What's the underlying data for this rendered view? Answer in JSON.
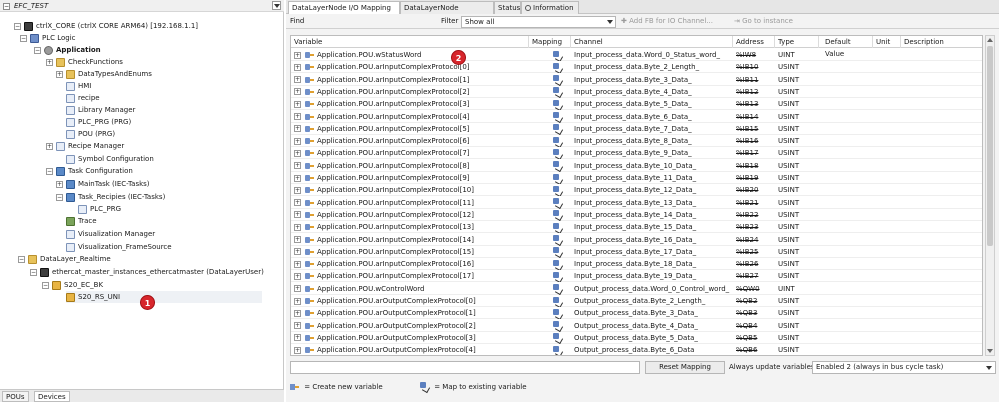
{
  "left": {
    "header_title": "EFC_TEST",
    "tree": [
      {
        "label": "ctrlX_CORE (ctrlX CORE ARM64) [192.168.1.1]",
        "icon": "device-icon"
      },
      {
        "label": "PLC Logic",
        "icon": "plc-icon"
      },
      {
        "label": "Application",
        "icon": "application-icon"
      },
      {
        "label": "CheckFunctions",
        "icon": "folder-icon"
      },
      {
        "label": "DataTypesAndEnums",
        "icon": "folder-icon"
      },
      {
        "label": "HMI",
        "icon": "hmi-icon"
      },
      {
        "label": "recipe",
        "icon": "recipe-icon"
      },
      {
        "label": "Library Manager",
        "icon": "library-icon"
      },
      {
        "label": "PLC_PRG (PRG)",
        "icon": "pou-icon"
      },
      {
        "label": "POU (PRG)",
        "icon": "pou-icon"
      },
      {
        "label": "Recipe Manager",
        "icon": "recipe-manager-icon"
      },
      {
        "label": "Symbol Configuration",
        "icon": "symbol-icon"
      },
      {
        "label": "Task Configuration",
        "icon": "task-config-icon"
      },
      {
        "label": "MainTask (IEC-Tasks)",
        "icon": "task-icon"
      },
      {
        "label": "Task_Recipies (IEC-Tasks)",
        "icon": "task-icon"
      },
      {
        "label": "PLC_PRG",
        "icon": "pou-icon"
      },
      {
        "label": "Trace",
        "icon": "trace-icon"
      },
      {
        "label": "Visualization Manager",
        "icon": "visu-manager-icon"
      },
      {
        "label": "Visualization_FrameSource",
        "icon": "visu-icon"
      },
      {
        "label": "DataLayer_Realtime",
        "icon": "folder-icon"
      },
      {
        "label": "ethercat_master_instances_ethercatmaster (DataLayerUser)",
        "icon": "ethercat-icon"
      },
      {
        "label": "S20_EC_BK",
        "icon": "slave-icon"
      },
      {
        "label": "S20_RS_UNI",
        "icon": "slave-icon"
      }
    ],
    "tabs": [
      "POUs",
      "Devices"
    ]
  },
  "badges": [
    "1",
    "2"
  ],
  "tabs": [
    "DataLayerNode I/O Mapping",
    "DataLayerNode Parameters",
    "Status",
    "Information"
  ],
  "toolbar": {
    "find_label": "Find",
    "filter_label": "Filter",
    "filter_value": "Show all",
    "add_fb": "Add FB for IO Channel...",
    "goto": "Go to instance"
  },
  "columns": [
    "Variable",
    "Mapping",
    "Channel",
    "Address",
    "Type",
    "Default Value",
    "Unit",
    "Description"
  ],
  "rows": [
    {
      "variable": "Application.POU.wStatusWord",
      "channel": "Input_process_data.Word_0_Status_word_",
      "address": "%IW8",
      "type": "UINT"
    },
    {
      "variable": "Application.POU.arInputComplexProtocol[0]",
      "channel": "Input_process_data.Byte_2_Length_",
      "address": "%IB10",
      "type": "USINT"
    },
    {
      "variable": "Application.POU.arInputComplexProtocol[1]",
      "channel": "Input_process_data.Byte_3_Data_",
      "address": "%IB11",
      "type": "USINT"
    },
    {
      "variable": "Application.POU.arInputComplexProtocol[2]",
      "channel": "Input_process_data.Byte_4_Data_",
      "address": "%IB12",
      "type": "USINT"
    },
    {
      "variable": "Application.POU.arInputComplexProtocol[3]",
      "channel": "Input_process_data.Byte_5_Data_",
      "address": "%IB13",
      "type": "USINT"
    },
    {
      "variable": "Application.POU.arInputComplexProtocol[4]",
      "channel": "Input_process_data.Byte_6_Data_",
      "address": "%IB14",
      "type": "USINT"
    },
    {
      "variable": "Application.POU.arInputComplexProtocol[5]",
      "channel": "Input_process_data.Byte_7_Data_",
      "address": "%IB15",
      "type": "USINT"
    },
    {
      "variable": "Application.POU.arInputComplexProtocol[6]",
      "channel": "Input_process_data.Byte_8_Data_",
      "address": "%IB16",
      "type": "USINT"
    },
    {
      "variable": "Application.POU.arInputComplexProtocol[7]",
      "channel": "Input_process_data.Byte_9_Data_",
      "address": "%IB17",
      "type": "USINT"
    },
    {
      "variable": "Application.POU.arInputComplexProtocol[8]",
      "channel": "Input_process_data.Byte_10_Data_",
      "address": "%IB18",
      "type": "USINT"
    },
    {
      "variable": "Application.POU.arInputComplexProtocol[9]",
      "channel": "Input_process_data.Byte_11_Data_",
      "address": "%IB19",
      "type": "USINT"
    },
    {
      "variable": "Application.POU.arInputComplexProtocol[10]",
      "channel": "Input_process_data.Byte_12_Data_",
      "address": "%IB20",
      "type": "USINT"
    },
    {
      "variable": "Application.POU.arInputComplexProtocol[11]",
      "channel": "Input_process_data.Byte_13_Data_",
      "address": "%IB21",
      "type": "USINT"
    },
    {
      "variable": "Application.POU.arInputComplexProtocol[12]",
      "channel": "Input_process_data.Byte_14_Data_",
      "address": "%IB22",
      "type": "USINT"
    },
    {
      "variable": "Application.POU.arInputComplexProtocol[13]",
      "channel": "Input_process_data.Byte_15_Data_",
      "address": "%IB23",
      "type": "USINT"
    },
    {
      "variable": "Application.POU.arInputComplexProtocol[14]",
      "channel": "Input_process_data.Byte_16_Data_",
      "address": "%IB24",
      "type": "USINT"
    },
    {
      "variable": "Application.POU.arInputComplexProtocol[15]",
      "channel": "Input_process_data.Byte_17_Data_",
      "address": "%IB25",
      "type": "USINT"
    },
    {
      "variable": "Application.POU.arInputComplexProtocol[16]",
      "channel": "Input_process_data.Byte_18_Data_",
      "address": "%IB26",
      "type": "USINT"
    },
    {
      "variable": "Application.POU.arInputComplexProtocol[17]",
      "channel": "Input_process_data.Byte_19_Data_",
      "address": "%IB27",
      "type": "USINT"
    },
    {
      "variable": "Application.POU.wControlWord",
      "channel": "Output_process_data.Word_0_Control_word_",
      "address": "%QW0",
      "type": "UINT"
    },
    {
      "variable": "Application.POU.arOutputComplexProtocol[0]",
      "channel": "Output_process_data.Byte_2_Length_",
      "address": "%QB2",
      "type": "USINT"
    },
    {
      "variable": "Application.POU.arOutputComplexProtocol[1]",
      "channel": "Output_process_data.Byte_3_Data_",
      "address": "%QB3",
      "type": "USINT"
    },
    {
      "variable": "Application.POU.arOutputComplexProtocol[2]",
      "channel": "Output_process_data.Byte_4_Data_",
      "address": "%QB4",
      "type": "USINT"
    },
    {
      "variable": "Application.POU.arOutputComplexProtocol[3]",
      "channel": "Output_process_data.Byte_5_Data_",
      "address": "%QB5",
      "type": "USINT"
    },
    {
      "variable": "Application.POU.arOutputComplexProtocol[4]",
      "channel": "Output_process_data.Byte_6_Data",
      "address": "%QB6",
      "type": "USINT"
    }
  ],
  "bottom": {
    "reset_label": "Reset Mapping",
    "always_label": "Always update variables",
    "select_value": "Enabled 2 (always in bus cycle task)"
  },
  "legend": {
    "create": "= Create new variable",
    "map": "= Map to existing variable"
  },
  "colors": {
    "badge": "#d7262c"
  }
}
